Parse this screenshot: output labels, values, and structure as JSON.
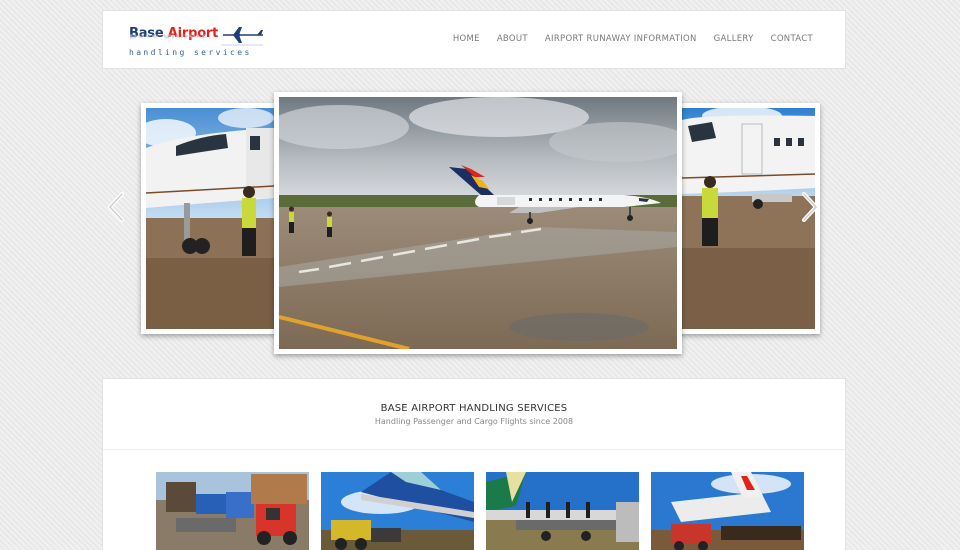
{
  "header": {
    "logo": {
      "word1": "Base",
      "word2": "Airport",
      "tagline": "handling services"
    },
    "nav": [
      {
        "label": "HOME"
      },
      {
        "label": "ABOUT"
      },
      {
        "label": "AIRPORT RUNAWAY INFORMATION"
      },
      {
        "label": "GALLERY"
      },
      {
        "label": "CONTACT"
      }
    ]
  },
  "slider": {
    "prev_icon": "chevron-left-icon",
    "next_icon": "chevron-right-icon",
    "slides": [
      "left",
      "center",
      "right"
    ]
  },
  "section": {
    "title": "BASE AIRPORT HANDLING SERVICES",
    "subtitle": "Handling Passenger and Cargo Flights since 2008"
  },
  "gallery": [
    "thumb-1",
    "thumb-2",
    "thumb-3",
    "thumb-4"
  ],
  "colors": {
    "brand_blue": "#1f3f7a",
    "brand_red": "#e2231a",
    "background": "#ececec"
  }
}
